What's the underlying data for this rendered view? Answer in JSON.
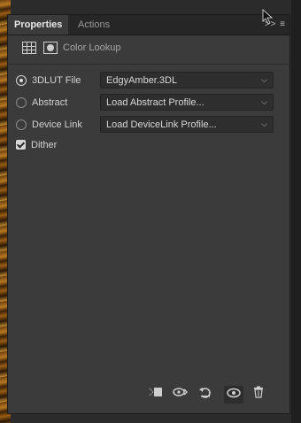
{
  "tabs": [
    {
      "label": "Properties",
      "active": true
    },
    {
      "label": "Actions",
      "active": false
    }
  ],
  "tab_controls": {
    "collapse": ">>",
    "menu": "≡"
  },
  "header": {
    "title": "Color Lookup",
    "icons": [
      "adjustment-grid-icon",
      "layer-mask-icon"
    ]
  },
  "options": [
    {
      "label": "3DLUT File",
      "checked": true,
      "value": "EdgyAmber.3DL"
    },
    {
      "label": "Abstract",
      "checked": false,
      "value": "Load Abstract Profile..."
    },
    {
      "label": "Device Link",
      "checked": false,
      "value": "Load DeviceLink Profile..."
    }
  ],
  "dither": {
    "label": "Dither",
    "checked": true
  },
  "footer_icons": [
    "clip-to-layer-icon",
    "view-previous-state-icon",
    "reset-icon",
    "visibility-eye-icon",
    "trash-icon"
  ],
  "colors": {
    "panel": "#3b3b3b",
    "tabbar": "#262626",
    "select": "#2e2e2e"
  }
}
